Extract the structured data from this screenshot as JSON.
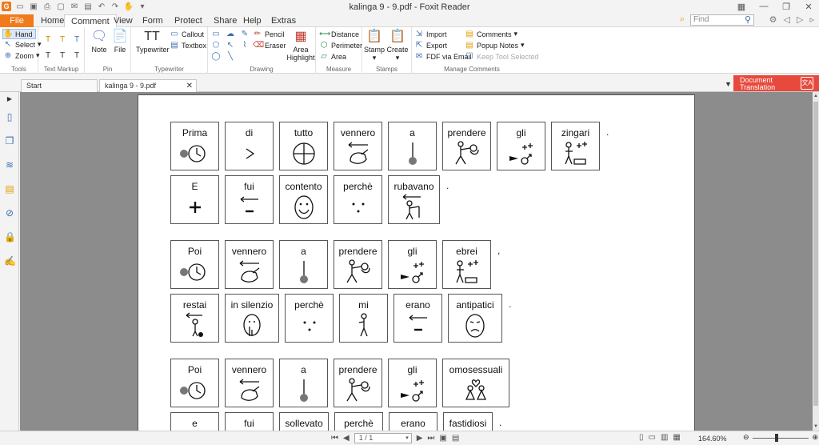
{
  "window": {
    "title": "kalinga 9 - 9.pdf - Foxit Reader"
  },
  "menu": {
    "file": "File",
    "tabs": [
      "Home",
      "Comment",
      "View",
      "Form",
      "Protect",
      "Share",
      "Help",
      "Extras"
    ],
    "active_tab": "Comment",
    "find_placeholder": "Find"
  },
  "ribbon": {
    "tools": {
      "label": "Tools",
      "hand": "Hand",
      "select": "Select",
      "zoom": "Zoom"
    },
    "text_markup": {
      "label": "Text Markup"
    },
    "pin": {
      "label": "Pin",
      "note": "Note",
      "file": "File"
    },
    "typewriter": {
      "label": "Typewriter",
      "typewriter": "Typewriter",
      "callout": "Callout",
      "textbox": "Textbox"
    },
    "drawing": {
      "label": "Drawing",
      "pencil": "Pencil",
      "eraser": "Eraser",
      "area_highlight": "Area Highlight"
    },
    "measure": {
      "label": "Measure",
      "distance": "Distance",
      "perimeter": "Perimeter",
      "area": "Area"
    },
    "stamps": {
      "label": "Stamps",
      "stamp": "Stamp",
      "create": "Create"
    },
    "manage": {
      "label": "Manage Comments",
      "import": "Import",
      "export": "Export",
      "fdf_email": "FDF via Email",
      "comments": "Comments",
      "popup_notes": "Popup Notes",
      "keep_tool": "Keep Tool Selected"
    }
  },
  "doc_tabs": {
    "start": "Start",
    "doc": "kalinga 9 - 9.pdf",
    "translate_line1": "Document",
    "translate_line2": "Translation"
  },
  "status": {
    "page": "1 / 1",
    "zoom": "164.60%"
  },
  "document": {
    "rows": [
      {
        "words": [
          "Prima",
          "di",
          "tutto",
          "vennero",
          "a",
          "prendere",
          "gli",
          "zingari"
        ],
        "icons": [
          "clock-dot",
          "gt",
          "circle-cross",
          "hand-left",
          "down-dot",
          "take",
          "male-plus",
          "people-plus"
        ],
        "end": "."
      },
      {
        "words": [
          "E",
          "fui",
          "contento",
          "perchè",
          "rubavano"
        ],
        "icons": [
          "plus",
          "minus-arrow",
          "happy-face",
          "dots",
          "thief"
        ],
        "end": "."
      },
      {
        "words": [
          "Poi",
          "vennero",
          "a",
          "prendere",
          "gli",
          "ebrei"
        ],
        "icons": [
          "clock-dot",
          "hand-left",
          "down-dot",
          "take",
          "male-plus",
          "people-plus"
        ],
        "end": ","
      },
      {
        "words": [
          "restai",
          "in silenzio",
          "perchè",
          "mi",
          "erano",
          "antipatici"
        ],
        "icons": [
          "stay",
          "silent",
          "dots",
          "me",
          "minus-arrow",
          "sad-face"
        ],
        "end": "."
      },
      {
        "words": [
          "Poi",
          "vennero",
          "a",
          "prendere",
          "gli",
          "omosessuali"
        ],
        "icons": [
          "clock-dot",
          "hand-left",
          "down-dot",
          "take",
          "male-plus",
          "couple"
        ],
        "end": ""
      },
      {
        "words": [
          "e",
          "fui",
          "sollevato",
          "perchè",
          "erano",
          "fastidiosi"
        ],
        "icons": [
          "",
          "",
          "",
          "",
          "",
          ""
        ],
        "end": "."
      }
    ]
  }
}
